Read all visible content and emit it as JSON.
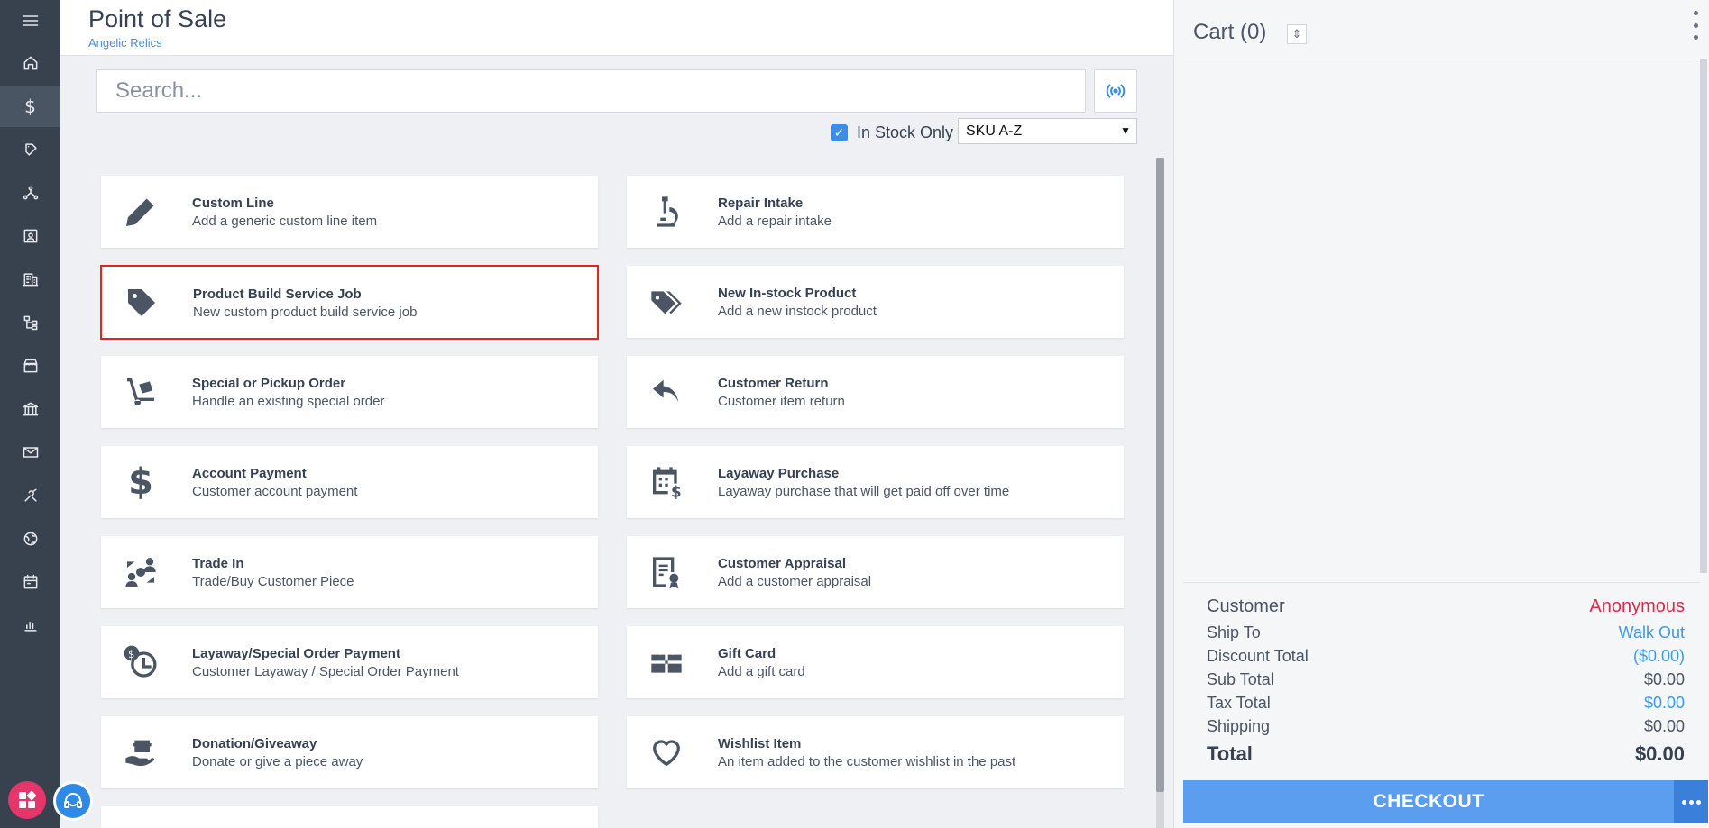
{
  "header": {
    "title": "Point of Sale",
    "store": "Angelic Relics"
  },
  "search": {
    "placeholder": "Search..."
  },
  "filters": {
    "in_stock_label": "In Stock Only",
    "in_stock_checked": true,
    "sort_value": "SKU A-Z"
  },
  "sidebar": {
    "items": [
      {
        "icon": "home-icon"
      },
      {
        "icon": "dollar-icon",
        "active": true
      },
      {
        "icon": "tags-icon"
      },
      {
        "icon": "network-icon"
      },
      {
        "icon": "contact-card-icon"
      },
      {
        "icon": "building-icon"
      },
      {
        "icon": "sitemap-icon"
      },
      {
        "icon": "store-icon"
      },
      {
        "icon": "bank-icon"
      },
      {
        "icon": "mail-icon"
      },
      {
        "icon": "tools-icon"
      },
      {
        "icon": "globe-icon"
      },
      {
        "icon": "calendar-icon"
      },
      {
        "icon": "chart-icon"
      }
    ]
  },
  "tiles": [
    {
      "title": "Custom Line",
      "subtitle": "Add a generic custom line item",
      "icon": "pencil-icon"
    },
    {
      "title": "Repair Intake",
      "subtitle": "Add a repair intake",
      "icon": "microscope-icon"
    },
    {
      "title": "Product Build Service Job",
      "subtitle": "New custom product build service job",
      "icon": "tag-icon"
    },
    {
      "title": "New In-stock Product",
      "subtitle": "Add a new instock product",
      "icon": "tags-icon"
    },
    {
      "title": "Special or Pickup Order",
      "subtitle": "Handle an existing special order",
      "icon": "hand-truck-icon"
    },
    {
      "title": "Customer Return",
      "subtitle": "Customer item return",
      "icon": "reply-icon"
    },
    {
      "title": "Account Payment",
      "subtitle": "Customer account payment",
      "icon": "dollar-icon"
    },
    {
      "title": "Layaway Purchase",
      "subtitle": "Layaway purchase that will get paid off over time",
      "icon": "calendar-dollar-icon"
    },
    {
      "title": "Trade In",
      "subtitle": "Trade/Buy Customer Piece",
      "icon": "trade-icon"
    },
    {
      "title": "Customer Appraisal",
      "subtitle": "Add a customer appraisal",
      "icon": "certificate-icon"
    },
    {
      "title": "Layaway/Special Order Payment",
      "subtitle": "Customer Layaway / Special Order Payment",
      "icon": "clock-dollar-icon"
    },
    {
      "title": "Gift Card",
      "subtitle": "Add a gift card",
      "icon": "gift-card-icon"
    },
    {
      "title": "Donation/Giveaway",
      "subtitle": "Donate or give a piece away",
      "icon": "hand-gift-icon"
    },
    {
      "title": "Wishlist Item",
      "subtitle": "An item added to the customer wishlist in the past",
      "icon": "heart-icon"
    }
  ],
  "cart": {
    "title": "Cart (0)",
    "customer_label": "Customer",
    "customer_value": "Anonymous",
    "ship_to_label": "Ship To",
    "ship_to_value": "Walk Out",
    "discount_label": "Discount Total",
    "discount_value": "($0.00)",
    "subtotal_label": "Sub Total",
    "subtotal_value": "$0.00",
    "tax_label": "Tax Total",
    "tax_value": "$0.00",
    "shipping_label": "Shipping",
    "shipping_value": "$0.00",
    "total_label": "Total",
    "total_value": "$0.00",
    "checkout_label": "CHECKOUT"
  },
  "colors": {
    "sidebar": "#38424f",
    "accent": "#3b8ee3",
    "checkout": "#5b9ef0",
    "selected_outline": "#e02424",
    "customer": "#e0284e"
  }
}
